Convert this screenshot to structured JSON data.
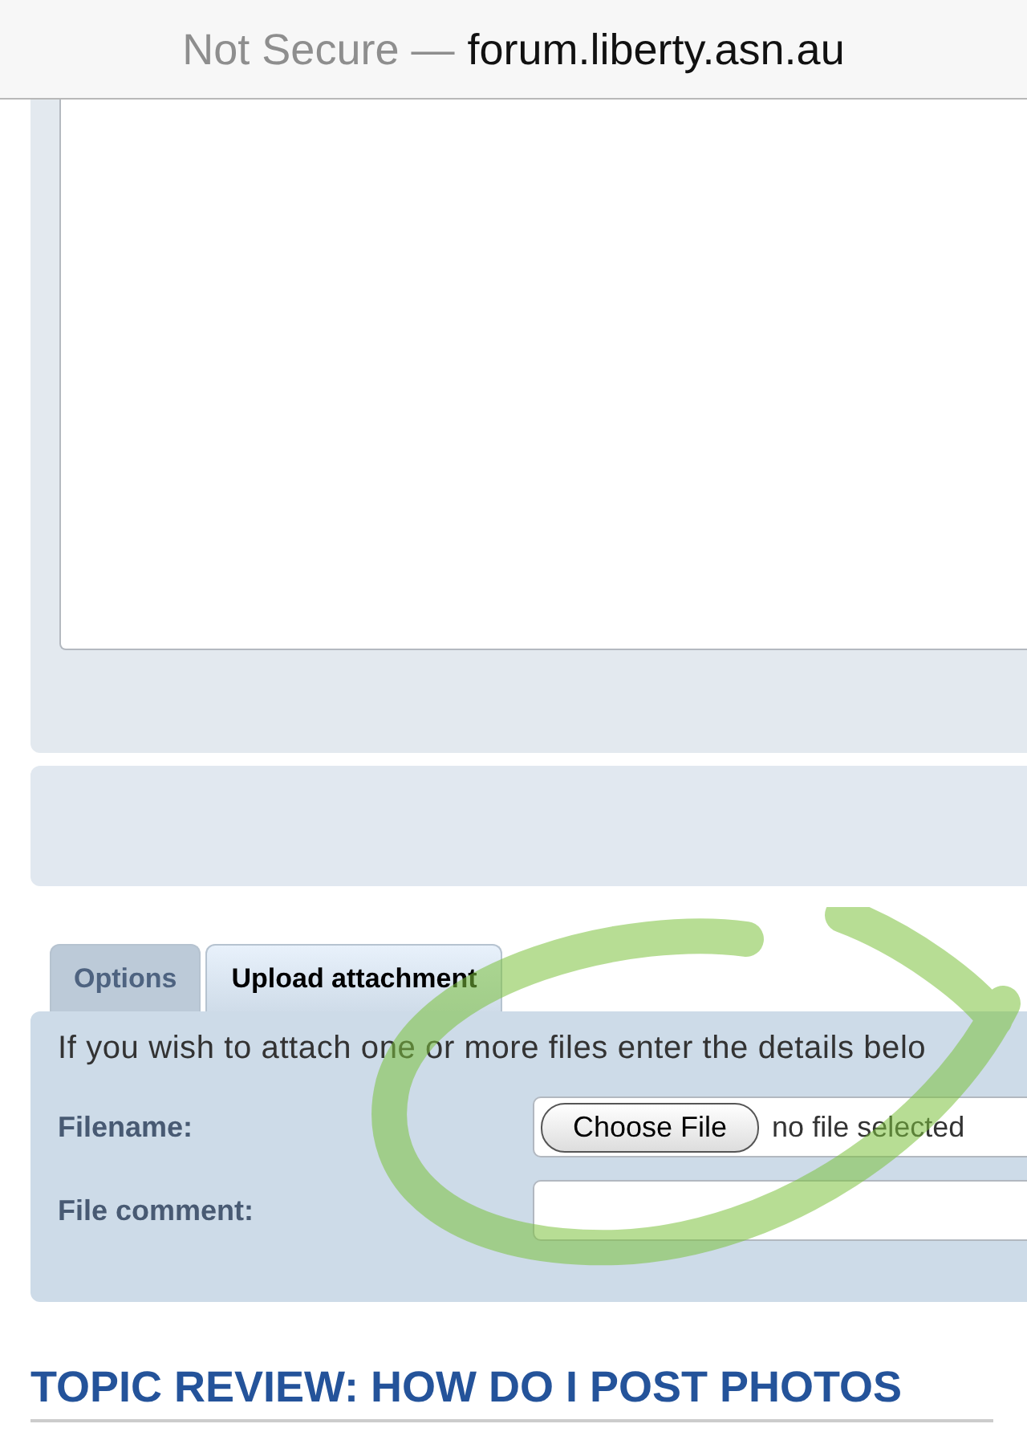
{
  "address_bar": {
    "security": "Not Secure —",
    "domain": "forum.liberty.asn.au"
  },
  "tabs": [
    {
      "label": "Options",
      "selected": false
    },
    {
      "label": "Upload attachment",
      "selected": true
    }
  ],
  "attachment_panel": {
    "intro": "If you wish to attach one or more files enter the details belo",
    "fields": [
      {
        "kind": "file",
        "label": "Filename:",
        "button": "Choose File",
        "status": "no file selected"
      },
      {
        "kind": "text",
        "label": "File comment:"
      }
    ]
  },
  "section_heading": "TOPIC REVIEW: HOW DO I POST PHOTOS"
}
